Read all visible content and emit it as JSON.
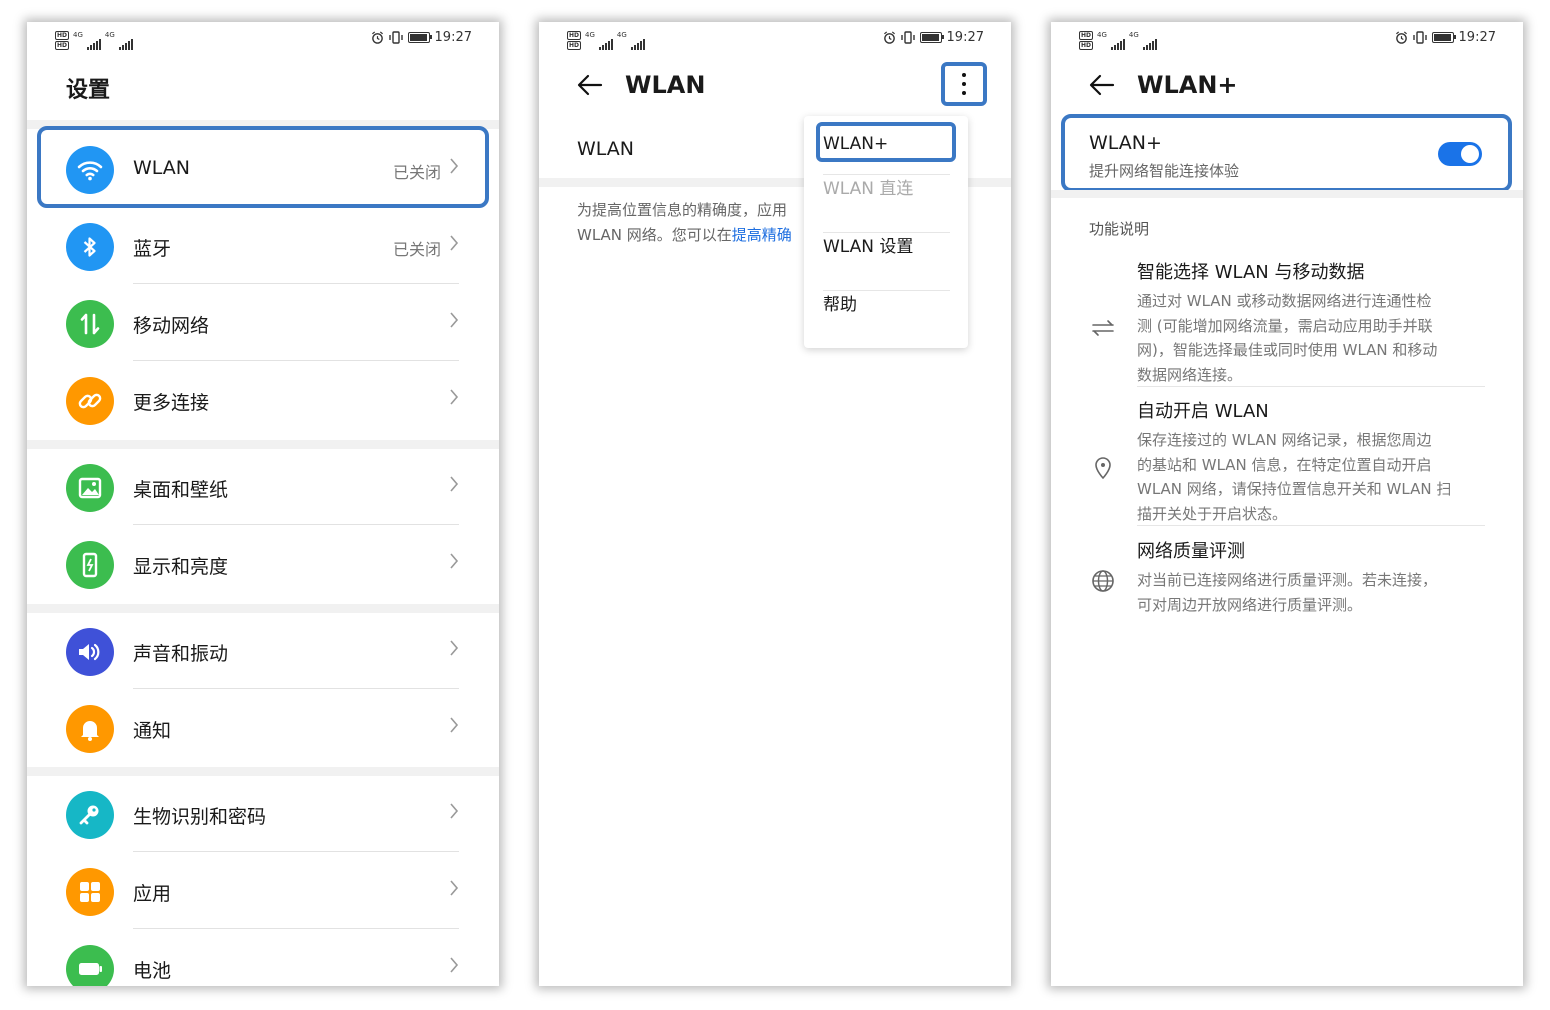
{
  "status": {
    "time": "19:27",
    "hd": "HD",
    "net": "4G"
  },
  "settings": {
    "title": "设置",
    "items": [
      {
        "label": "WLAN",
        "value": "已关闭",
        "icon": "wifi-icon",
        "color": "#2196f3"
      },
      {
        "label": "蓝牙",
        "value": "已关闭",
        "icon": "bluetooth-icon",
        "color": "#2196f3"
      },
      {
        "label": "移动网络",
        "value": "",
        "icon": "mobile-data-icon",
        "color": "#3cbd4f"
      },
      {
        "label": "更多连接",
        "value": "",
        "icon": "link-icon",
        "color": "#ff9800"
      },
      {
        "label": "桌面和壁纸",
        "value": "",
        "icon": "wallpaper-icon",
        "color": "#3cbd4f"
      },
      {
        "label": "显示和亮度",
        "value": "",
        "icon": "display-icon",
        "color": "#3cbd4f"
      },
      {
        "label": "声音和振动",
        "value": "",
        "icon": "sound-icon",
        "color": "#3f51d8"
      },
      {
        "label": "通知",
        "value": "",
        "icon": "bell-icon",
        "color": "#ff9800"
      },
      {
        "label": "生物识别和密码",
        "value": "",
        "icon": "key-icon",
        "color": "#16b7c6"
      },
      {
        "label": "应用",
        "value": "",
        "icon": "apps-icon",
        "color": "#ff9800"
      },
      {
        "label": "电池",
        "value": "",
        "icon": "battery-icon",
        "color": "#3cbd4f"
      }
    ]
  },
  "wlan": {
    "title": "WLAN",
    "toggle_label": "WLAN",
    "desc_line1": "为提高位置信息的精确度，应用",
    "desc_line2": "WLAN 网络。您可以在",
    "desc_link": "提高精确",
    "menu": [
      "WLAN+",
      "WLAN 直连",
      "WLAN 设置",
      "帮助"
    ]
  },
  "wlanplus": {
    "title": "WLAN+",
    "main_label": "WLAN+",
    "main_sub": "提升网络智能连接体验",
    "section": "功能说明",
    "features": [
      {
        "title": "智能选择 WLAN 与移动数据",
        "lines": [
          "通过对 WLAN 或移动数据网络进行连通性检",
          "测 (可能增加网络流量，需启动应用助手并联",
          "网)，智能选择最佳或同时使用 WLAN 和移动",
          "数据网络连接。"
        ]
      },
      {
        "title": "自动开启 WLAN",
        "lines": [
          "保存连接过的 WLAN 网络记录，根据您周边",
          "的基站和 WLAN 信息，在特定位置自动开启",
          "WLAN 网络，请保持位置信息开关和 WLAN 扫",
          "描开关处于开启状态。"
        ]
      },
      {
        "title": "网络质量评测",
        "lines": [
          "对当前已连接网络进行质量评测。若未连接，",
          "可对周边开放网络进行质量评测。"
        ]
      }
    ]
  }
}
